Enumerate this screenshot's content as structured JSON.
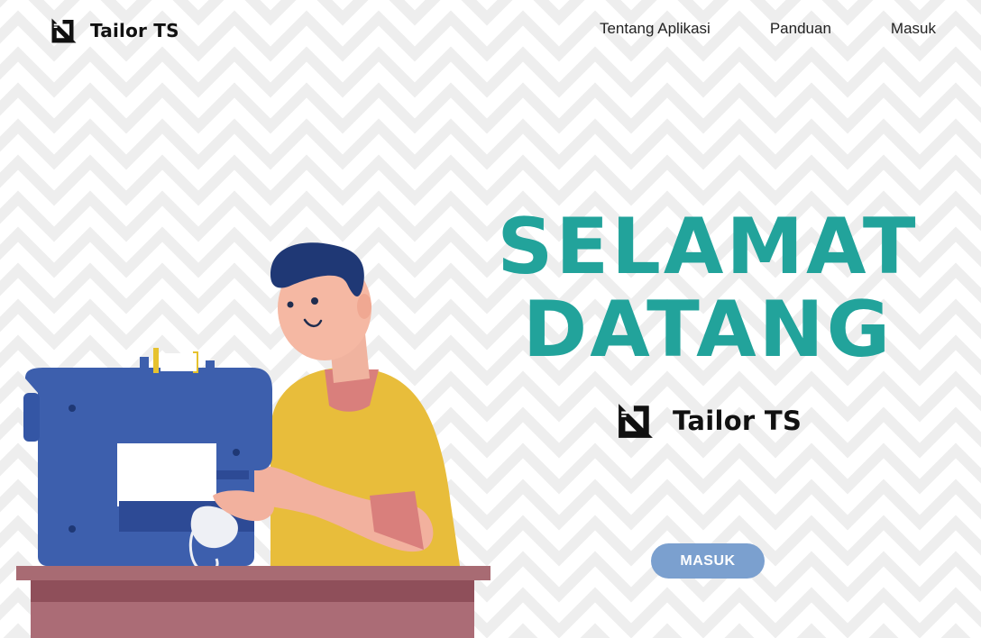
{
  "header": {
    "brand_name": "Tailor TS",
    "brand_icon": "tailor-ruler-icon",
    "nav": {
      "about": "Tentang Aplikasi",
      "guide": "Panduan",
      "login": "Masuk"
    }
  },
  "hero": {
    "title_line1": "SELAMAT",
    "title_line2": "DATANG",
    "brand_name": "Tailor TS",
    "brand_icon": "tailor-ruler-icon",
    "cta_label": "MASUK"
  },
  "colors": {
    "accent": "#22a39b",
    "button": "#7ba0cf",
    "pattern": "#efefef",
    "text": "#111111"
  }
}
